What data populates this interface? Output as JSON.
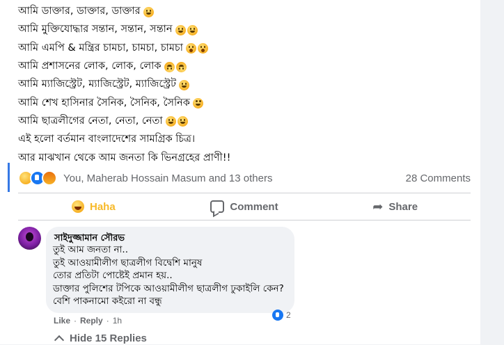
{
  "post": {
    "lines": [
      {
        "text": "আমি ডাক্তার, ডাক্তার, ডাক্তার",
        "emojis": [
          "grin"
        ]
      },
      {
        "text": "আমি মুক্তিযোদ্ধার সন্তান, সন্তান, সন্তান",
        "emojis": [
          "grin",
          "grin"
        ]
      },
      {
        "text": "আমি এমপি & মন্ত্রির চামচা, চামচা, চামচা",
        "emojis": [
          "shock",
          "shock"
        ]
      },
      {
        "text": "আমি প্রশাসনের লোক, লোক, লোক",
        "emojis": [
          "upside-down",
          "upside-down"
        ]
      },
      {
        "text": "আমি ম্যাজিস্ট্রেট, ম্যাজিস্ট্রেট, ম্যাজিস্ট্রেট",
        "emojis": [
          "grin"
        ]
      },
      {
        "text": "আমি শেখ হাসিনার সৈনিক, সৈনিক, সৈনিক",
        "emojis": [
          "eye-roll"
        ]
      },
      {
        "text": "আমি ছাত্রলীগের নেতা, নেতা, নেতা",
        "emojis": [
          "grin",
          "grin"
        ]
      },
      {
        "text": "এই হলো বর্তমান বাংলাদেশের সামগ্রিক চিত্র।",
        "emojis": []
      },
      {
        "text": "আর মাঝখান থেকে আম জনতা কি ভিনগ্রহের প্রাণী!!",
        "emojis": []
      }
    ]
  },
  "summary": {
    "reaction_icons": [
      "haha-icon",
      "like-icon",
      "angry-icon"
    ],
    "names": "You, Maherab Hossain Masum and 13 others",
    "comments": "28 Comments"
  },
  "actions": {
    "haha": "Haha",
    "comment": "Comment",
    "share": "Share"
  },
  "comment": {
    "author": "সাইদুজ্জামান সৌরভ",
    "lines": [
      "তুই আম জনতা না..",
      "তুই আওয়ামীলীগ ছাত্রলীগ বিদ্বেশি মানুষ",
      "তোর প্রতিটা পোষ্টেই প্রমান হয়..",
      "ডাক্তার পুলিশের টপিকে আওয়ামীলীগ ছাত্রলীগ ঢুকাইলি কেন?",
      "বেশি পাকনামো কইরো না বন্ধু"
    ],
    "reaction_count": "2",
    "like": "Like",
    "reply": "Reply",
    "time": "1h",
    "separator": "·"
  },
  "replies": {
    "label": "Hide 15 Replies"
  },
  "colors": {
    "accent": "#3578e5",
    "haha": "#f7b928",
    "muted": "#65676b",
    "bubble": "#f0f2f5"
  }
}
